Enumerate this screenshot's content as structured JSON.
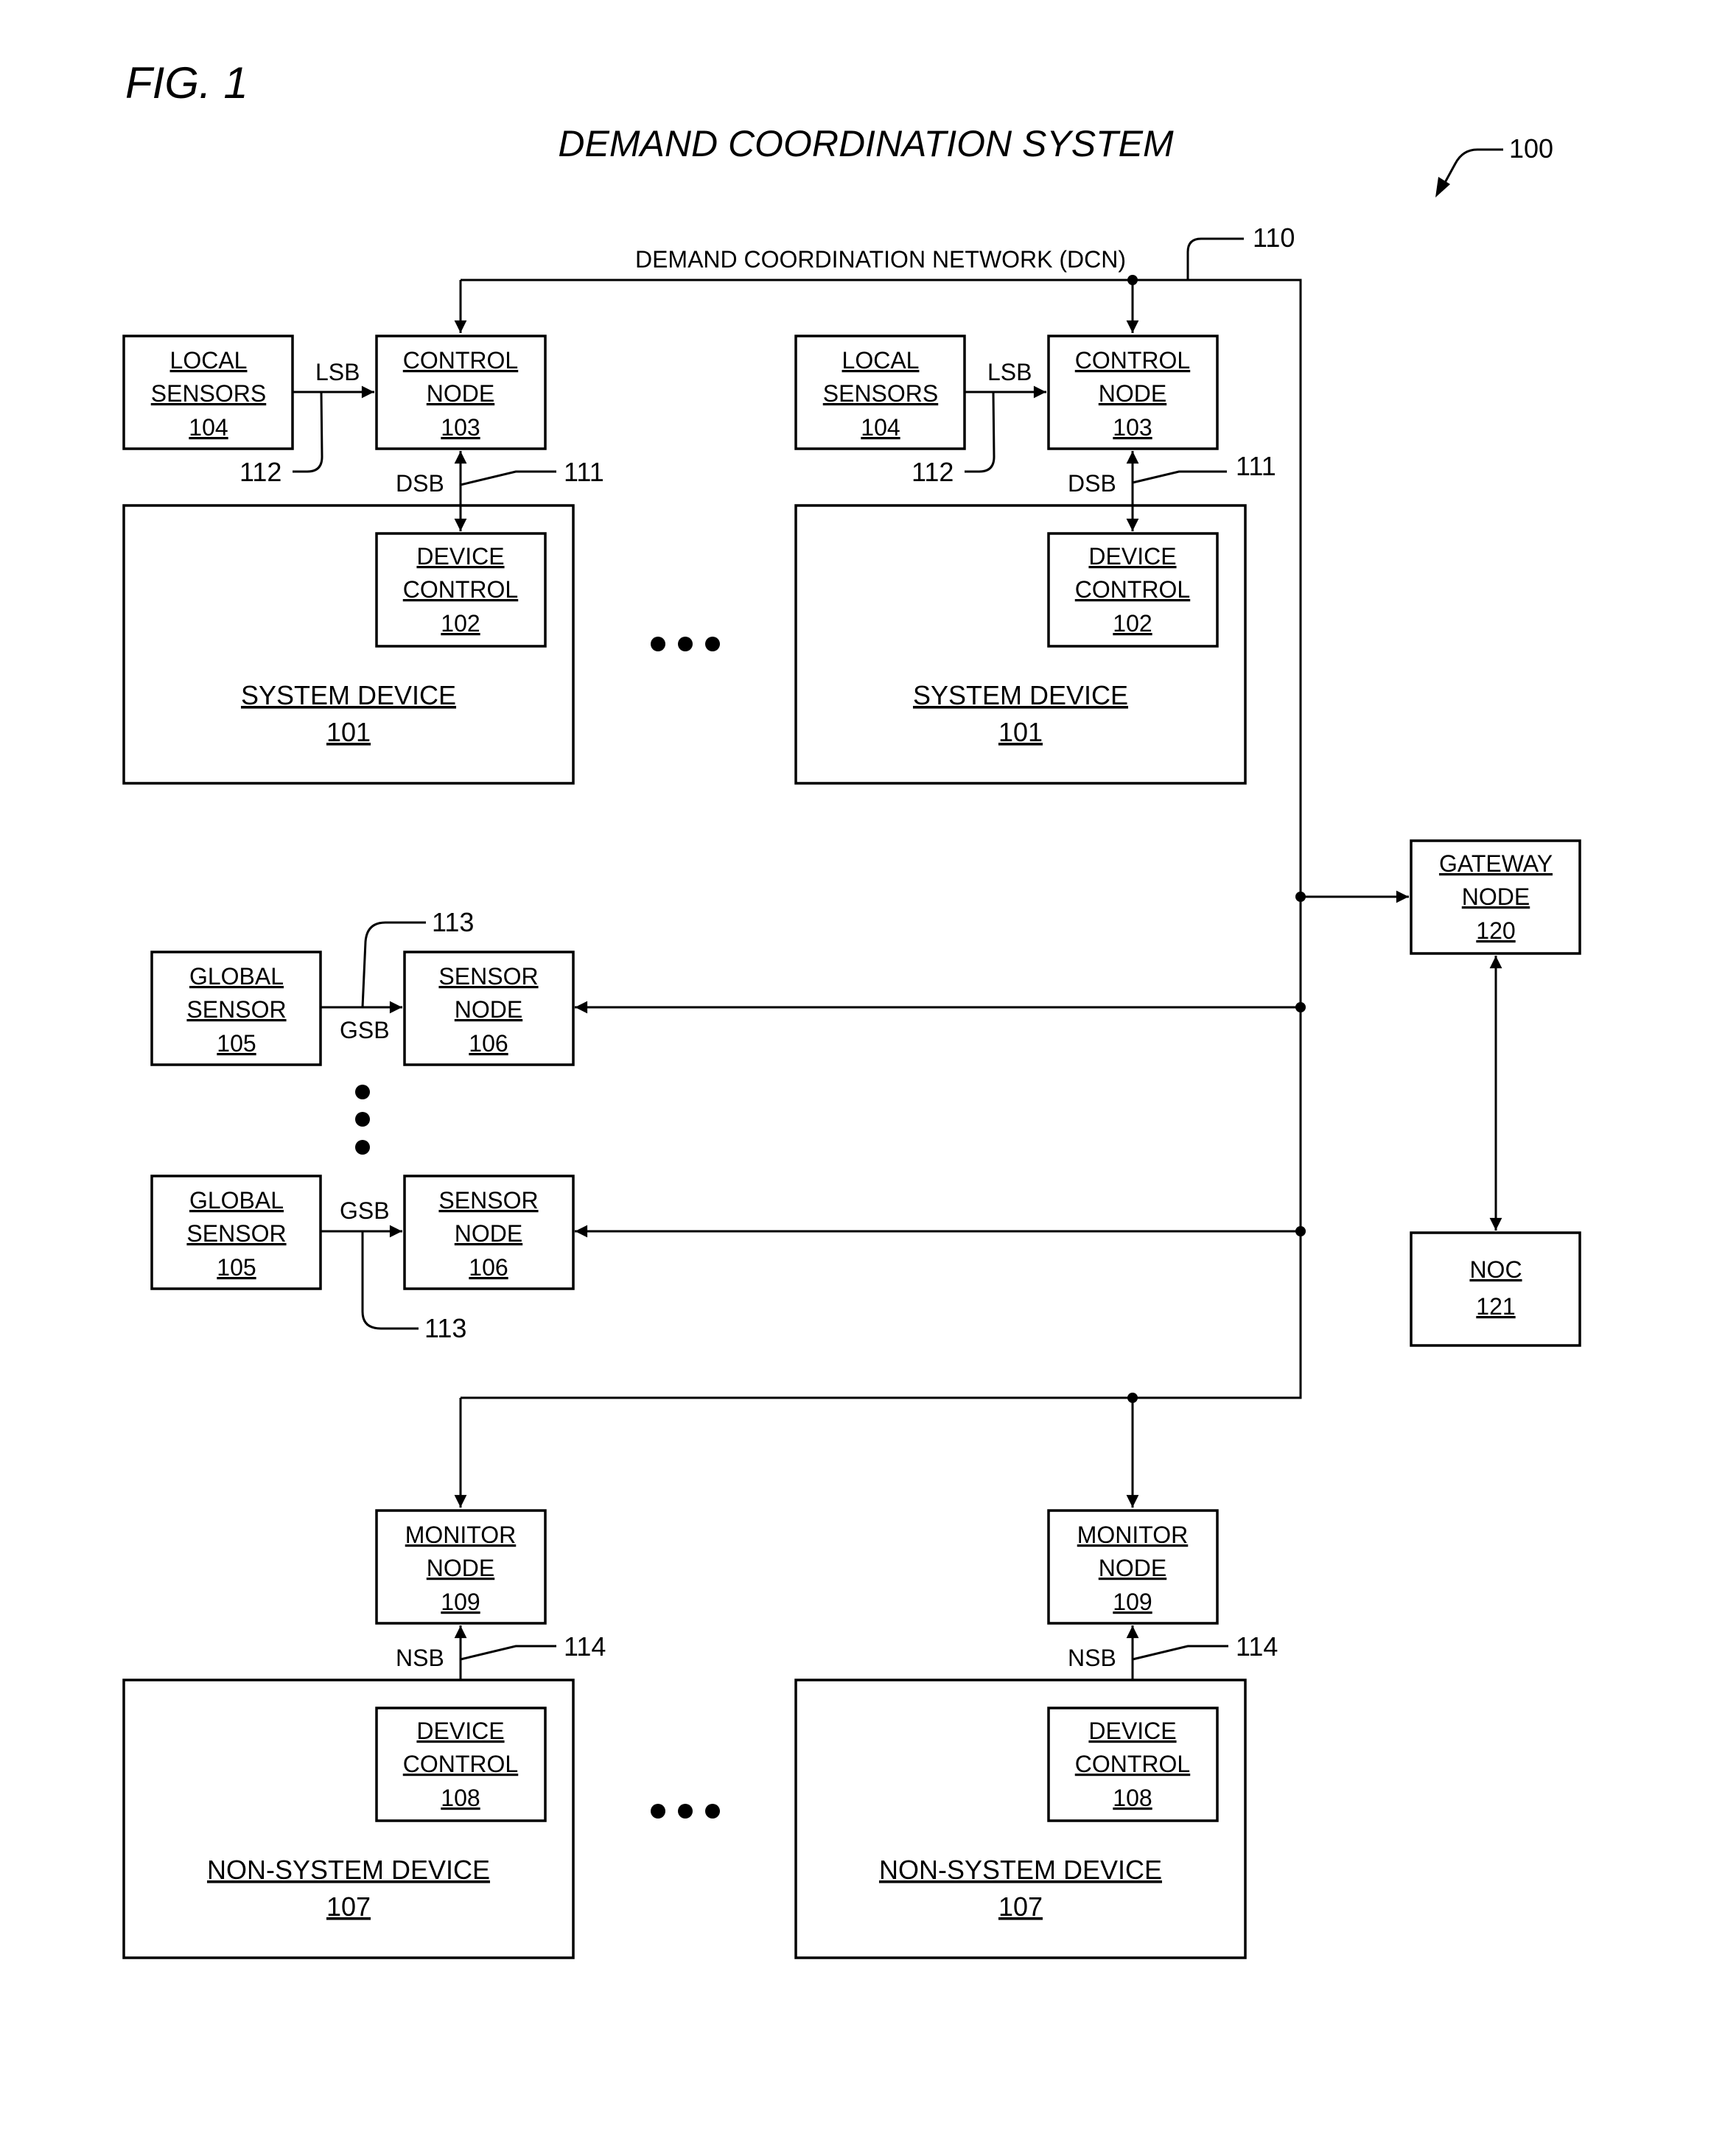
{
  "figure": {
    "fig_label": "FIG. 1",
    "title": "DEMAND COORDINATION SYSTEM",
    "system_ref": "100"
  },
  "network": {
    "label": "DEMAND COORDINATION NETWORK (DCN)",
    "ref": "110"
  },
  "system_devices": [
    {
      "local_sensors": [
        "LOCAL",
        "SENSORS",
        "104"
      ],
      "control_node": [
        "CONTROL",
        "NODE",
        "103"
      ],
      "device_control": [
        "DEVICE",
        "CONTROL",
        "102"
      ],
      "device": [
        "SYSTEM DEVICE",
        "101"
      ],
      "lsb": "LSB",
      "lsb_ref": "112",
      "dsb": "DSB",
      "dsb_ref": "111"
    },
    {
      "local_sensors": [
        "LOCAL",
        "SENSORS",
        "104"
      ],
      "control_node": [
        "CONTROL",
        "NODE",
        "103"
      ],
      "device_control": [
        "DEVICE",
        "CONTROL",
        "102"
      ],
      "device": [
        "SYSTEM DEVICE",
        "101"
      ],
      "lsb": "LSB",
      "lsb_ref": "112",
      "dsb": "DSB",
      "dsb_ref": "111"
    }
  ],
  "sensor_groups": [
    {
      "global_sensor": [
        "GLOBAL",
        "SENSOR",
        "105"
      ],
      "sensor_node": [
        "SENSOR",
        "NODE",
        "106"
      ],
      "gsb": "GSB",
      "gsb_ref": "113"
    },
    {
      "global_sensor": [
        "GLOBAL",
        "SENSOR",
        "105"
      ],
      "sensor_node": [
        "SENSOR",
        "NODE",
        "106"
      ],
      "gsb": "GSB",
      "gsb_ref": "113"
    }
  ],
  "gateway": [
    "GATEWAY",
    "NODE",
    "120"
  ],
  "noc": [
    "NOC",
    "121"
  ],
  "non_system_devices": [
    {
      "monitor_node": [
        "MONITOR",
        "NODE",
        "109"
      ],
      "device_control": [
        "DEVICE",
        "CONTROL",
        "108"
      ],
      "device": [
        "NON-SYSTEM DEVICE",
        "107"
      ],
      "nsb": "NSB",
      "nsb_ref": "114"
    },
    {
      "monitor_node": [
        "MONITOR",
        "NODE",
        "109"
      ],
      "device_control": [
        "DEVICE",
        "CONTROL",
        "108"
      ],
      "device": [
        "NON-SYSTEM DEVICE",
        "107"
      ],
      "nsb": "NSB",
      "nsb_ref": "114"
    }
  ],
  "ellipsis": "..."
}
